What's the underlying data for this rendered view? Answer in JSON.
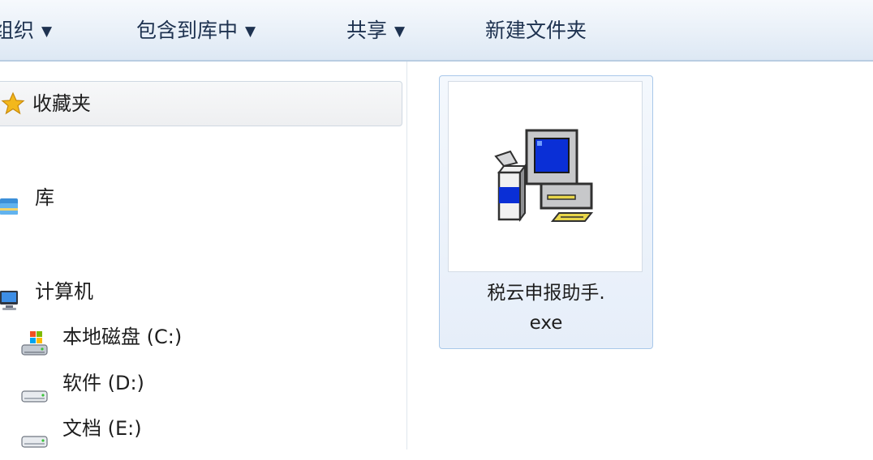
{
  "toolbar": {
    "organize": "组织",
    "include_in_library": "包含到库中",
    "share": "共享",
    "new_folder": "新建文件夹",
    "caret": "▼"
  },
  "nav": {
    "favorites": "收藏夹",
    "libraries": "库",
    "computer": "计算机",
    "drives": [
      {
        "label": "本地磁盘 (C:)"
      },
      {
        "label": "软件 (D:)"
      },
      {
        "label": "文档 (E:)"
      }
    ]
  },
  "files": [
    {
      "name_line1": "税云申报助手.",
      "name_line2": "exe",
      "icon": "installer-exe-icon"
    }
  ],
  "colors": {
    "toolbar_text": "#1e3250",
    "selection_border": "#a9c8ea",
    "selection_fill": "#e6eef9",
    "star": "#f3b81c",
    "screen_blue": "#0a2fd6"
  }
}
